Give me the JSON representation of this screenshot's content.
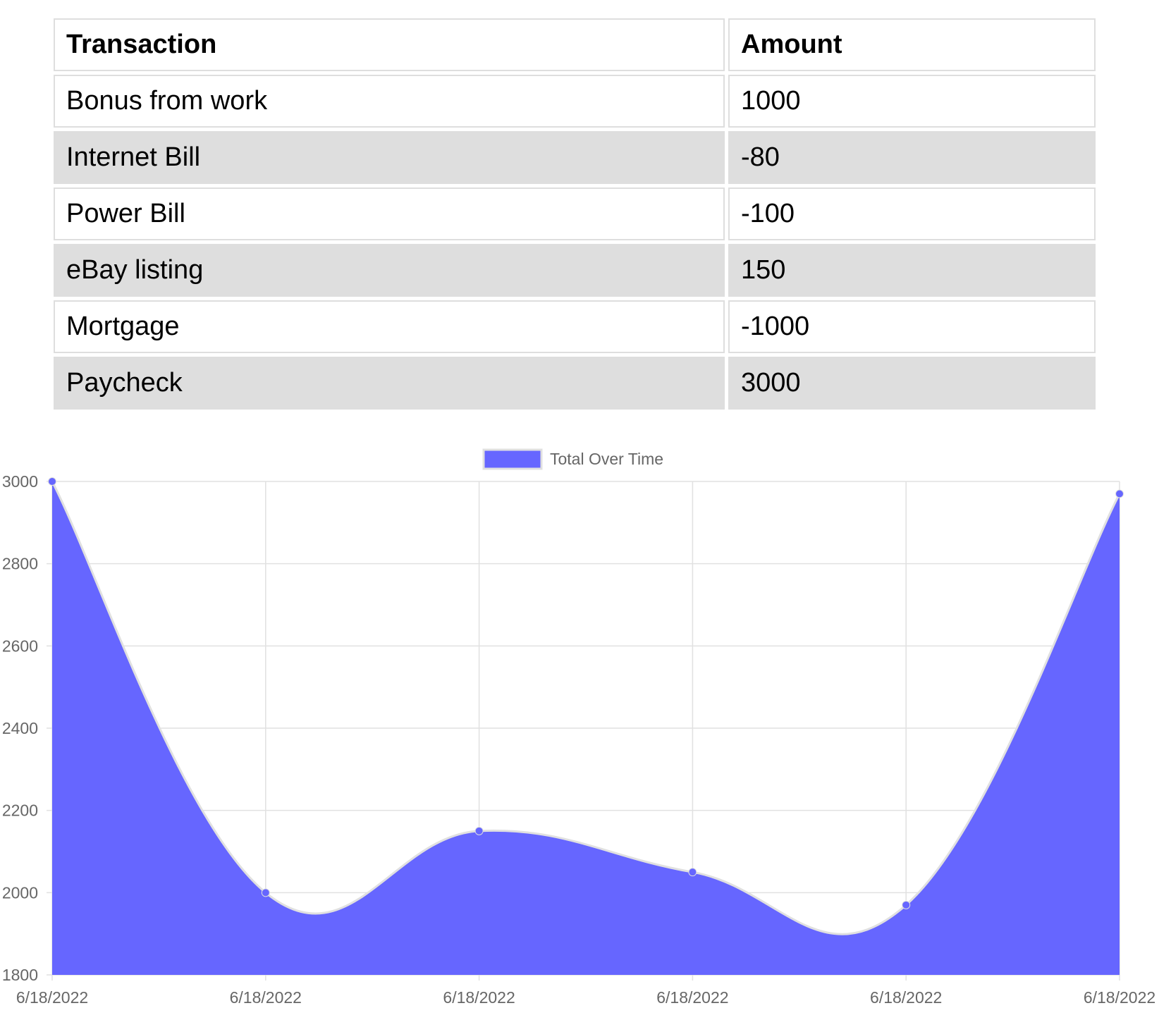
{
  "table": {
    "headers": {
      "transaction": "Transaction",
      "amount": "Amount"
    },
    "rows": [
      {
        "name": "Bonus from work",
        "amount": "1000"
      },
      {
        "name": "Internet Bill",
        "amount": "-80"
      },
      {
        "name": "Power Bill",
        "amount": "-100"
      },
      {
        "name": "eBay listing",
        "amount": "150"
      },
      {
        "name": "Mortgage",
        "amount": "-1000"
      },
      {
        "name": "Paycheck",
        "amount": "3000"
      }
    ]
  },
  "chart_data": {
    "type": "area",
    "categories": [
      "6/18/2022",
      "6/18/2022",
      "6/18/2022",
      "6/18/2022",
      "6/18/2022",
      "6/18/2022"
    ],
    "series": [
      {
        "name": "Total Over Time",
        "values": [
          3000,
          2000,
          2150,
          2050,
          1970,
          2970
        ],
        "color": "#6666ff"
      }
    ],
    "ylim": [
      1800,
      3000
    ],
    "yticks": [
      1800,
      2000,
      2200,
      2400,
      2600,
      2800,
      3000
    ],
    "grid": true,
    "legend_position": "top-center",
    "colors": {
      "fill": "#6666ff",
      "line": "#e0e0e0",
      "point": "#6666ff",
      "grid": "#e1e1e1",
      "tick_text": "#666666"
    }
  }
}
